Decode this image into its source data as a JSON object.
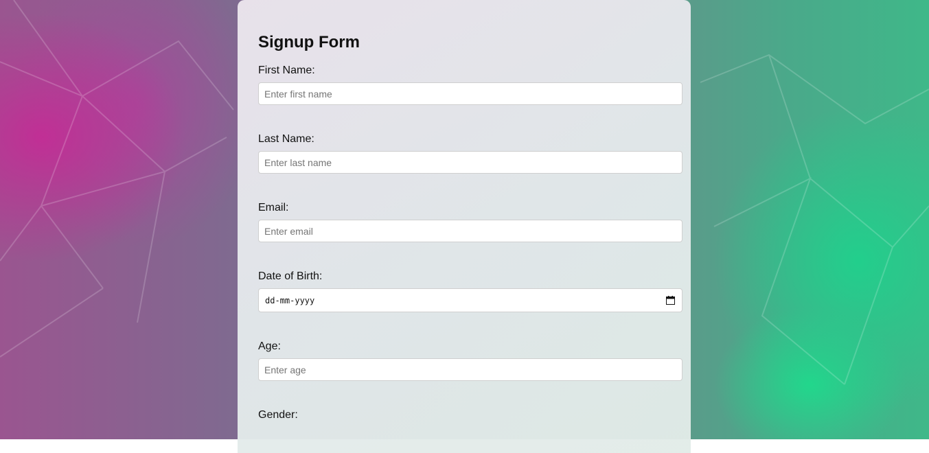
{
  "form": {
    "title": "Signup Form",
    "fields": {
      "first_name": {
        "label": "First Name:",
        "placeholder": "Enter first name"
      },
      "last_name": {
        "label": "Last Name:",
        "placeholder": "Enter last name"
      },
      "email": {
        "label": "Email:",
        "placeholder": "Enter email"
      },
      "dob": {
        "label": "Date of Birth:",
        "placeholder": "dd-mm-yyyy",
        "icon": "calendar-icon"
      },
      "age": {
        "label": "Age:",
        "placeholder": "Enter age"
      },
      "gender": {
        "label": "Gender:"
      }
    }
  },
  "colors": {
    "background_left": "#b8369c",
    "background_right": "#2ccf8c",
    "card": "#e4e7ea"
  }
}
